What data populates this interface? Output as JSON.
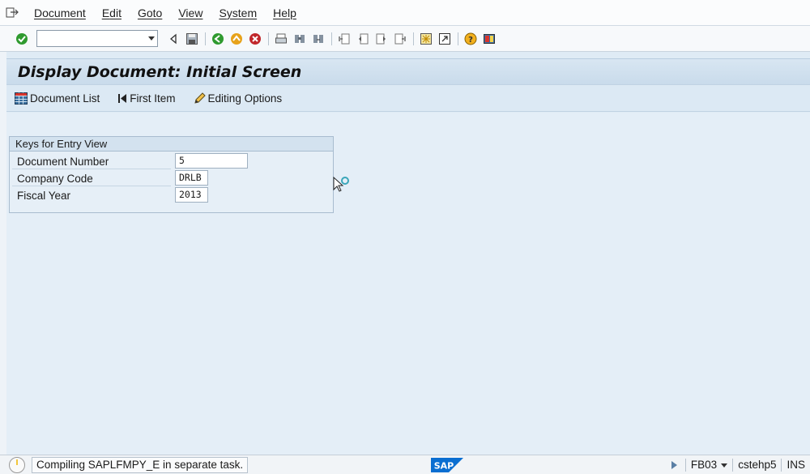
{
  "menu": {
    "items": [
      "Document",
      "Edit",
      "Goto",
      "View",
      "System",
      "Help"
    ]
  },
  "toolbar": {
    "command_field_value": "",
    "icons": [
      "enter-icon",
      "back-icon",
      "save-icon",
      "back-green-icon",
      "exit-icon",
      "cancel-icon",
      "print-icon",
      "find-icon",
      "find-next-icon",
      "first-page-icon",
      "prev-page-icon",
      "next-page-icon",
      "last-page-icon",
      "create-session-icon",
      "shortcut-icon",
      "help-icon",
      "layout-menu-icon"
    ]
  },
  "title": "Display Document: Initial Screen",
  "app_toolbar": {
    "document_list": "Document List",
    "first_item": "First Item",
    "editing_options": "Editing Options"
  },
  "group": {
    "title": "Keys for Entry View",
    "fields": [
      {
        "label": "Document Number",
        "value": "5"
      },
      {
        "label": "Company Code",
        "value": "DRLB"
      },
      {
        "label": "Fiscal Year",
        "value": "2013"
      }
    ]
  },
  "status": {
    "message": "Compiling SAPLFMPY_E in separate task.",
    "logo": "SAP",
    "transaction": "FB03",
    "server": "cstehp5",
    "mode": "INS"
  },
  "colors": {
    "background": "#dfebf5",
    "title_bar": "#c9dbeb",
    "accent_green": "#2f9a2f",
    "accent_red": "#c0262b",
    "accent_orange": "#e7a21a",
    "sap_blue": "#0a6ed1"
  }
}
